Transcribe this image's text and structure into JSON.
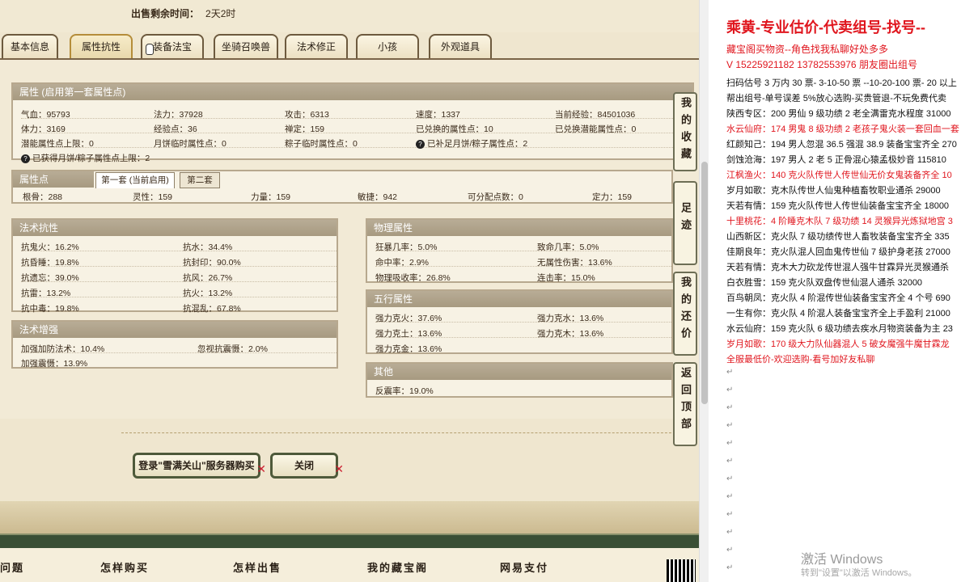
{
  "sale": {
    "label": "出售剩余时间：",
    "value": "2天2时"
  },
  "tabs": [
    "基本信息",
    "属性抗性",
    "装备法宝",
    "坐骑召唤兽",
    "法术修正",
    "小孩",
    "外观道具"
  ],
  "attr_box": {
    "title": "属性 (启用第一套属性点)",
    "rows": [
      [
        "气血：95793",
        "法力：37928",
        "攻击：6313",
        "速度：1337",
        "当前经验：84501036"
      ],
      [
        "体力：3169",
        "经验点：36",
        "禅定：159",
        "已兑换的属性点：10",
        "已兑换潜能属性点：0"
      ],
      [
        "潜能属性点上限：0",
        "月饼临时属性点：0",
        "粽子临时属性点：0",
        "已补足月饼/粽子属性点：2",
        ""
      ]
    ],
    "obtained": "已获得月饼/粽子属性点上限：2"
  },
  "points_box": {
    "title": "属性点",
    "subtabs": [
      "第一套 (当前启用)",
      "第二套"
    ],
    "items": [
      "根骨：288",
      "灵性：159",
      "力量：159",
      "敏捷：942",
      "可分配点数：0",
      "定力：159"
    ]
  },
  "spell_resist": {
    "title": "法术抗性",
    "items": [
      "抗鬼火：16.2%",
      "抗水：34.4%",
      "抗昏睡：19.8%",
      "抗封印：90.0%",
      "抗遗忘：39.0%",
      "抗风：26.7%",
      "抗雷：13.2%",
      "抗火：13.2%",
      "抗中毒：19.8%",
      "抗混乱：67.8%"
    ]
  },
  "spell_boost": {
    "title": "法术增强",
    "items": [
      "加强加防法术：10.4%",
      "忽视抗震慑：2.0%",
      "加强震慑：13.9%"
    ]
  },
  "physical": {
    "title": "物理属性",
    "items": [
      "狂暴几率：5.0%",
      "致命几率：5.0%",
      "命中率：2.9%",
      "无属性伤害：13.6%",
      "物理吸收率：26.8%",
      "连击率：15.0%"
    ]
  },
  "elements": {
    "title": "五行属性",
    "items": [
      "强力克火：37.6%",
      "强力克水：13.6%",
      "强力克土：13.6%",
      "强力克木：13.6%",
      "强力克金：13.6%"
    ]
  },
  "other": {
    "title": "其他",
    "items": [
      "反震率：19.0%"
    ]
  },
  "buttons": {
    "login": "登录\"雪满关山\"服务器购买",
    "close": "关闭"
  },
  "side_tools": [
    "我的收藏",
    "足迹",
    "我的还价",
    "返回顶部"
  ],
  "footer_nav": [
    "问题",
    "怎样购买",
    "怎样出售",
    "我的藏宝阁",
    "网易支付"
  ],
  "doc": {
    "title": "乘黄-专业估价-代卖组号-找号--",
    "lines": [
      {
        "t": "藏宝阁买物资--角色找我私聊好处多多",
        "red": true
      },
      {
        "t": "V 15225921182   13782553976 朋友圈出组号",
        "red": true
      },
      {
        "t": "扫码估号 3 万内 30 票- 3-10-50 票  --10-20-100 票- 20 以上",
        "red": false
      },
      {
        "t": "帮出组号-单号误差 5%放心选购-买贵管退-不玩免费代卖",
        "red": false
      },
      {
        "t": "陕西专区：200 男仙 9 级功绩 2 老全满雷克水程度 31000",
        "red": false
      },
      {
        "t": "水云仙府：174 男鬼 8 级功绩 2 老孩子鬼火装一套回血一套",
        "red": true
      },
      {
        "t": "红颜知己：194 男人忽混 36.5 强混 38.9 装备宝宝齐全 270",
        "red": false
      },
      {
        "t": "剑蚀沧海：197 男人 2 老 5 正骨混心猿孟极妙音 115810",
        "red": false
      },
      {
        "t": "江枫渔火：140 克火队传世人传世仙无价女鬼装备齐全 10",
        "red": true
      },
      {
        "t": "岁月如歌：克木队传世人仙鬼种植畜牧职业通杀 29000",
        "red": false
      },
      {
        "t": "天若有情：159 克火队传世人传世仙装备宝宝齐全 18000",
        "red": false
      },
      {
        "t": "十里桃花：4 阶睡克木队 7 级功绩 14 灵猴异光炼狱地宫 3",
        "red": true
      },
      {
        "t": "山西新区：克火队 7 级功绩传世人畜牧装备宝宝齐全 335",
        "red": false
      },
      {
        "t": "佳期良年：克火队混人回血鬼传世仙 7 级护身老孩 27000",
        "red": false
      },
      {
        "t": "天若有情：克木大力砍龙传世混人强牛甘霖异光灵猴通杀",
        "red": false
      },
      {
        "t": "白衣胜雪：159 克火队双盘传世仙混人通杀 32000",
        "red": false
      },
      {
        "t": "百鸟朝凤：克火队 4 阶混传世仙装备宝宝齐全 4 个号 690",
        "red": false
      },
      {
        "t": "一生有你：克火队 4 阶混人装备宝宝齐全上手盈利 21000",
        "red": false
      },
      {
        "t": "水云仙府：159 克火队 6 级功绩去疾水月物资装备为主 23",
        "red": false
      },
      {
        "t": "岁月如歌：170 级大力队仙器混人 5 破女魔强牛魔甘霖龙",
        "red": true
      },
      {
        "t": "全服最低价-欢迎选购-看号加好友私聊",
        "red": true
      }
    ],
    "watermark1": "激活 Windows",
    "watermark2": "转到\"设置\"以激活 Windows。"
  }
}
